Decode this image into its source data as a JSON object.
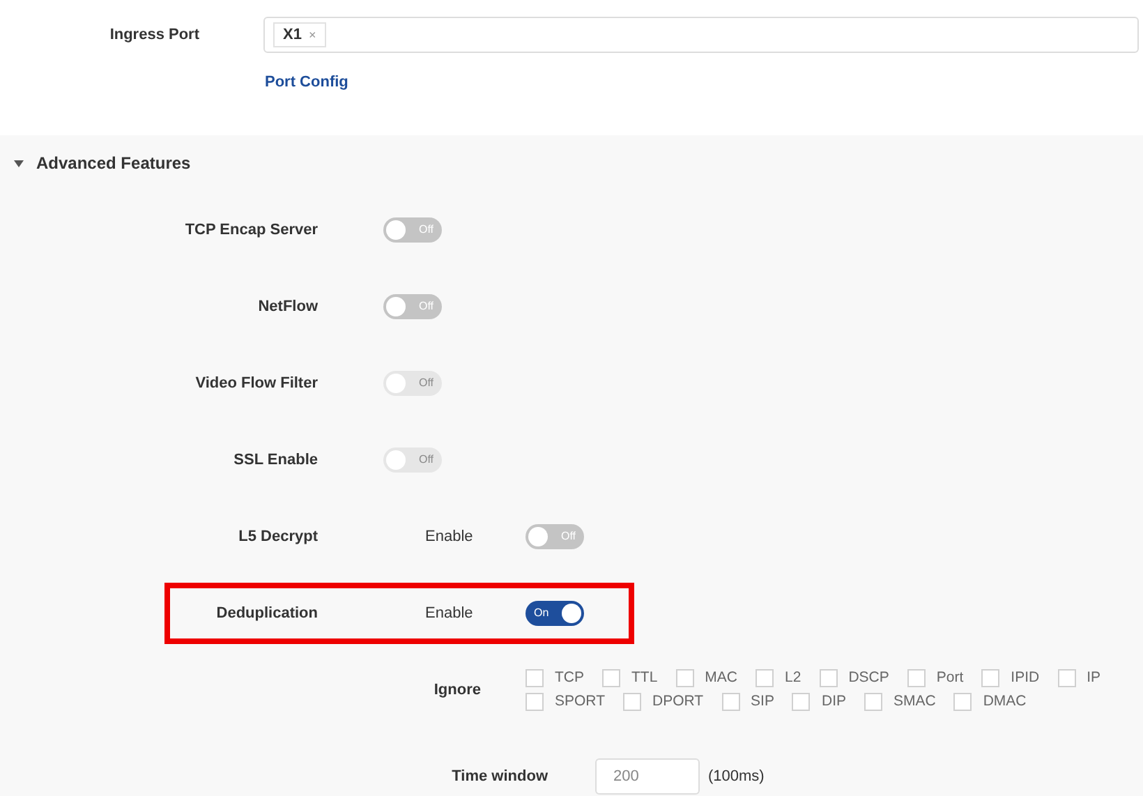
{
  "ingress": {
    "label": "Ingress Port",
    "tags": [
      {
        "text": "X1",
        "remove": "×"
      }
    ],
    "link": "Port Config"
  },
  "advanced": {
    "title": "Advanced Features",
    "expanded": true,
    "features": [
      {
        "kind": "switch",
        "label": "TCP Encap Server",
        "on": false,
        "disabled": false,
        "switch_text": "Off"
      },
      {
        "kind": "switch",
        "label": "NetFlow",
        "on": false,
        "disabled": false,
        "switch_text": "Off"
      },
      {
        "kind": "switch",
        "label": "Video Flow Filter",
        "on": false,
        "disabled": true,
        "switch_text": "Off"
      },
      {
        "kind": "switch",
        "label": "SSL Enable",
        "on": false,
        "disabled": true,
        "switch_text": "Off"
      },
      {
        "kind": "enable",
        "label": "L5 Decrypt",
        "sub_label": "Enable",
        "on": false,
        "disabled": false,
        "switch_text": "Off",
        "highlighted": false
      },
      {
        "kind": "enable",
        "label": "Deduplication",
        "sub_label": "Enable",
        "on": true,
        "disabled": false,
        "switch_text": "On",
        "highlighted": true
      }
    ],
    "ignore": {
      "label": "Ignore",
      "rows": [
        [
          {
            "label": "TCP",
            "checked": false
          },
          {
            "label": "TTL",
            "checked": false
          },
          {
            "label": "MAC",
            "checked": false
          },
          {
            "label": "L2",
            "checked": false
          },
          {
            "label": "DSCP",
            "checked": false
          },
          {
            "label": "Port",
            "checked": false
          },
          {
            "label": "IPID",
            "checked": false
          },
          {
            "label": "IP",
            "checked": false
          }
        ],
        [
          {
            "label": "SPORT",
            "checked": false
          },
          {
            "label": "DPORT",
            "checked": false
          },
          {
            "label": "SIP",
            "checked": false
          },
          {
            "label": "DIP",
            "checked": false
          },
          {
            "label": "SMAC",
            "checked": false
          },
          {
            "label": "DMAC",
            "checked": false
          }
        ]
      ]
    },
    "time_window": {
      "label": "Time window",
      "value": "200",
      "unit": "(100ms)"
    }
  }
}
